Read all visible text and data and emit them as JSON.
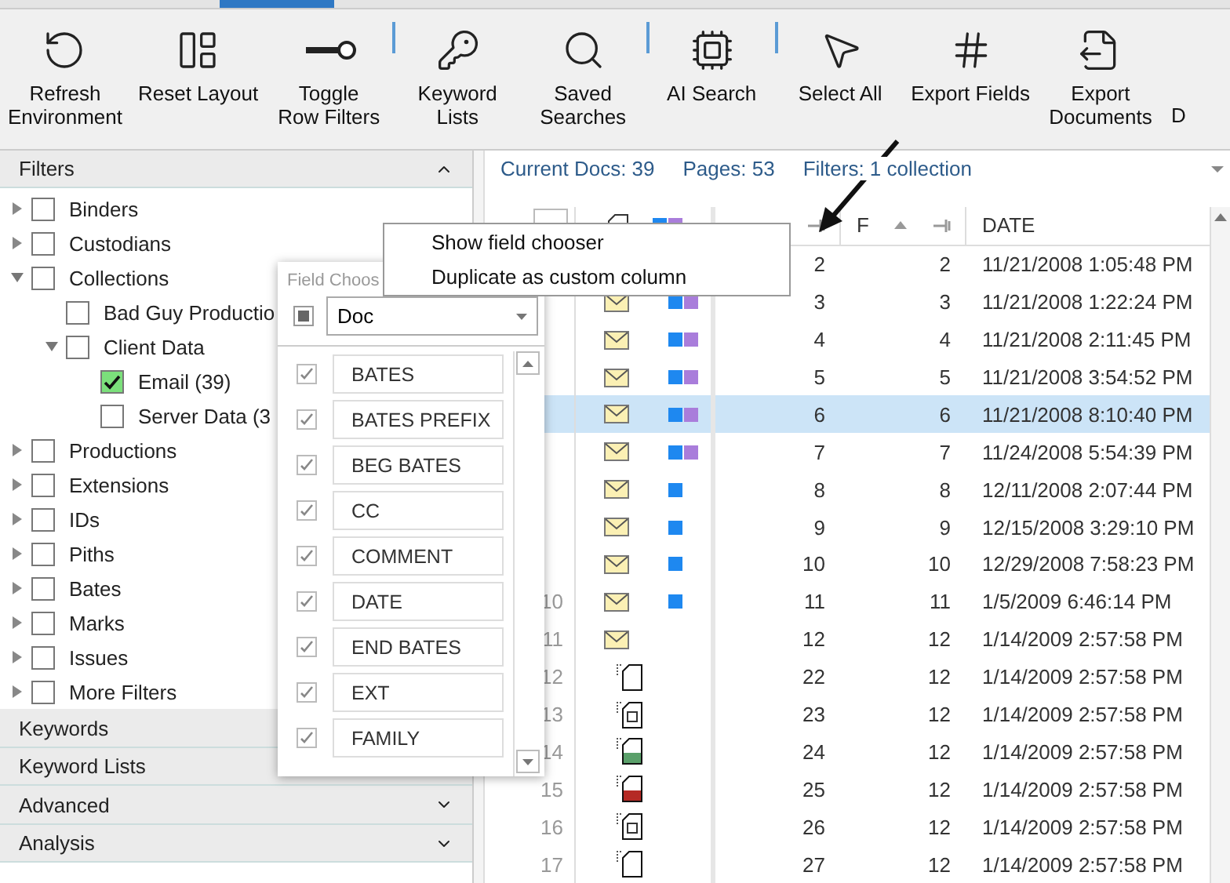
{
  "toolbar": {
    "groups": [
      [
        {
          "label": "Refresh Environment"
        },
        {
          "label": "Reset Layout"
        },
        {
          "label": "Toggle Row Filters"
        }
      ],
      [
        {
          "label": "Keyword Lists"
        },
        {
          "label": "Saved Searches"
        }
      ],
      [
        {
          "label": "AI Search"
        }
      ],
      [
        {
          "label": "Select All"
        },
        {
          "label": "Export Fields"
        },
        {
          "label": "Export Documents"
        },
        {
          "label": "D"
        }
      ]
    ]
  },
  "filters": {
    "title": "Filters",
    "expanded": true,
    "items": [
      {
        "label": "Binders",
        "checked": false,
        "expanded": false
      },
      {
        "label": "Custodians",
        "checked": false,
        "expanded": false
      },
      {
        "label": "Collections",
        "checked": false,
        "expanded": true,
        "children": [
          {
            "label": "Bad Guy Productio",
            "checked": false
          },
          {
            "label": "Client Data",
            "checked": false,
            "expanded": true,
            "children": [
              {
                "label": "Email (39)",
                "checked": true
              },
              {
                "label": "Server Data (3",
                "checked": false
              }
            ]
          }
        ]
      },
      {
        "label": "Productions",
        "checked": false,
        "expanded": false
      },
      {
        "label": "Extensions",
        "checked": false,
        "expanded": false
      },
      {
        "label": "IDs",
        "checked": false,
        "expanded": false
      },
      {
        "label": "Piths",
        "checked": false,
        "expanded": false
      },
      {
        "label": "Bates",
        "checked": false,
        "expanded": false
      },
      {
        "label": "Marks",
        "checked": false,
        "expanded": false
      },
      {
        "label": "Issues",
        "checked": false,
        "expanded": false
      },
      {
        "label": "More Filters",
        "checked": false,
        "expanded": false
      }
    ]
  },
  "sections": [
    {
      "label": "Keywords"
    },
    {
      "label": "Keyword Lists"
    },
    {
      "label": "Advanced",
      "expanded": false
    },
    {
      "label": "Analysis",
      "expanded": false
    }
  ],
  "info_bar": [
    "Current Docs: 39",
    "Pages: 53",
    "Filters: 1 collection"
  ],
  "grid": {
    "columns": [
      {
        "label": "F"
      },
      {
        "label": "DATE"
      }
    ],
    "rows": [
      {
        "id": "2",
        "fa": "2",
        "date": "11/21/2008 1:05:48 PM",
        "selected": false
      },
      {
        "id": "3",
        "fa": "3",
        "date": "11/21/2008 1:22:24 PM",
        "selected": false,
        "kind": "email",
        "tags": [
          {
            "color": "#1e88f0"
          },
          {
            "color": "#a97ddb"
          }
        ]
      },
      {
        "id": "4",
        "fa": "4",
        "date": "11/21/2008 2:11:45 PM",
        "selected": false,
        "kind": "email",
        "tags": [
          {
            "color": "#1e88f0"
          },
          {
            "color": "#a97ddb"
          }
        ]
      },
      {
        "id": "5",
        "fa": "5",
        "date": "11/21/2008 3:54:52 PM",
        "selected": false,
        "kind": "email",
        "tags": [
          {
            "color": "#1e88f0"
          },
          {
            "color": "#a97ddb"
          }
        ]
      },
      {
        "id": "6",
        "fa": "6",
        "date": "11/21/2008 8:10:40 PM",
        "selected": true,
        "kind": "email",
        "tags": [
          {
            "color": "#1e88f0"
          },
          {
            "color": "#a97ddb"
          }
        ]
      },
      {
        "id": "7",
        "fa": "7",
        "date": "11/24/2008 5:54:39 PM",
        "selected": false,
        "kind": "email",
        "tags": [
          {
            "color": "#1e88f0"
          },
          {
            "color": "#a97ddb"
          }
        ]
      },
      {
        "id": "8",
        "fa": "8",
        "date": "12/11/2008 2:07:44 PM",
        "selected": false,
        "kind": "email",
        "tags": [
          {
            "color": "#1e88f0"
          }
        ]
      },
      {
        "id": "9",
        "fa": "9",
        "date": "12/15/2008 3:29:10 PM",
        "selected": false,
        "kind": "email",
        "tags": [
          {
            "color": "#1e88f0"
          }
        ]
      },
      {
        "id": "10",
        "fa": "10",
        "date": "12/29/2008 7:58:23 PM",
        "selected": false,
        "kind": "email",
        "tags": [
          {
            "color": "#1e88f0"
          }
        ]
      },
      {
        "number": "10",
        "id": "11",
        "fa": "11",
        "date": "1/5/2009 6:46:14 PM",
        "selected": false,
        "kind": "email",
        "tags": [
          {
            "color": "#1e88f0"
          }
        ]
      },
      {
        "number": "11",
        "id": "12",
        "fa": "12",
        "date": "1/14/2009 2:57:58 PM",
        "selected": false,
        "kind": "email"
      },
      {
        "number": "12",
        "id": "22",
        "fa": "12",
        "date": "1/14/2009 2:57:58 PM",
        "selected": false,
        "kind": "doc"
      },
      {
        "number": "13",
        "id": "23",
        "fa": "12",
        "date": "1/14/2009 2:57:58 PM",
        "selected": false,
        "kind": "image"
      },
      {
        "number": "14",
        "id": "24",
        "fa": "12",
        "date": "1/14/2009 2:57:58 PM",
        "selected": false,
        "kind": "sheet"
      },
      {
        "number": "15",
        "id": "25",
        "fa": "12",
        "date": "1/14/2009 2:57:58 PM",
        "selected": false,
        "kind": "pdf"
      },
      {
        "number": "16",
        "id": "26",
        "fa": "12",
        "date": "1/14/2009 2:57:58 PM",
        "selected": false,
        "kind": "image"
      },
      {
        "number": "17",
        "id": "27",
        "fa": "12",
        "date": "1/14/2009 2:57:58 PM",
        "selected": false,
        "kind": "doc"
      }
    ]
  },
  "field_chooser": {
    "title": "Field Choos",
    "select": {
      "value": "Doc",
      "partial": true
    },
    "fields": [
      {
        "label": "BATES",
        "checked": true
      },
      {
        "label": "BATES PREFIX",
        "checked": true
      },
      {
        "label": "BEG BATES",
        "checked": true
      },
      {
        "label": "CC",
        "checked": true
      },
      {
        "label": "COMMENT",
        "checked": true
      },
      {
        "label": "DATE",
        "checked": true
      },
      {
        "label": "END BATES",
        "checked": true
      },
      {
        "label": "EXT",
        "checked": true
      },
      {
        "label": "FAMILY",
        "checked": true
      }
    ]
  },
  "context_menu": [
    "Show field chooser",
    "Duplicate as custom column"
  ]
}
